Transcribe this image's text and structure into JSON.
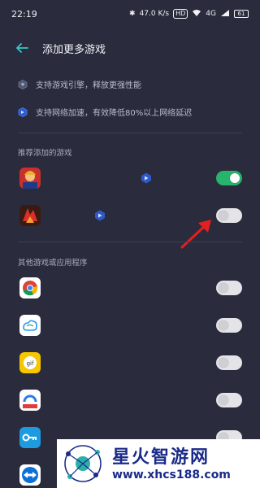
{
  "status_bar": {
    "time": "22:19",
    "speed": "47.0 K/s",
    "hd": "HD",
    "signal": "4G",
    "battery": "61"
  },
  "header": {
    "back_icon": "back-arrow-icon",
    "title": "添加更多游戏"
  },
  "features": [
    {
      "icon": "engine-icon",
      "text": "支持游戏引擎，释放更强性能"
    },
    {
      "icon": "network-accelerate-icon",
      "text": "支持网络加速，有效降低80%以上网络延迟"
    }
  ],
  "recommended": {
    "title": "推荐添加的游戏",
    "apps": [
      {
        "icon": "game-anime-icon",
        "accel_badge": true,
        "enabled": true
      },
      {
        "icon": "game-sanguo-icon",
        "accel_badge": true,
        "enabled": false
      }
    ]
  },
  "others": {
    "title": "其他游戏或应用程序",
    "apps": [
      {
        "icon": "chrome-icon",
        "enabled": false
      },
      {
        "icon": "cloud-app-icon",
        "enabled": false
      },
      {
        "icon": "gif-app-icon",
        "enabled": false
      },
      {
        "icon": "video-app-icon",
        "enabled": false
      },
      {
        "icon": "key-app-icon",
        "enabled": false
      },
      {
        "icon": "teamviewer-icon",
        "enabled": false
      }
    ]
  },
  "watermark": {
    "title": "星火智游网",
    "url": "www.xhcs188.com"
  },
  "colors": {
    "background": "#2a2c3d",
    "toggle_on": "#27b46c",
    "toggle_off": "#e4e4e8",
    "accent": "#3a7bff",
    "arrow": "#e32020"
  }
}
